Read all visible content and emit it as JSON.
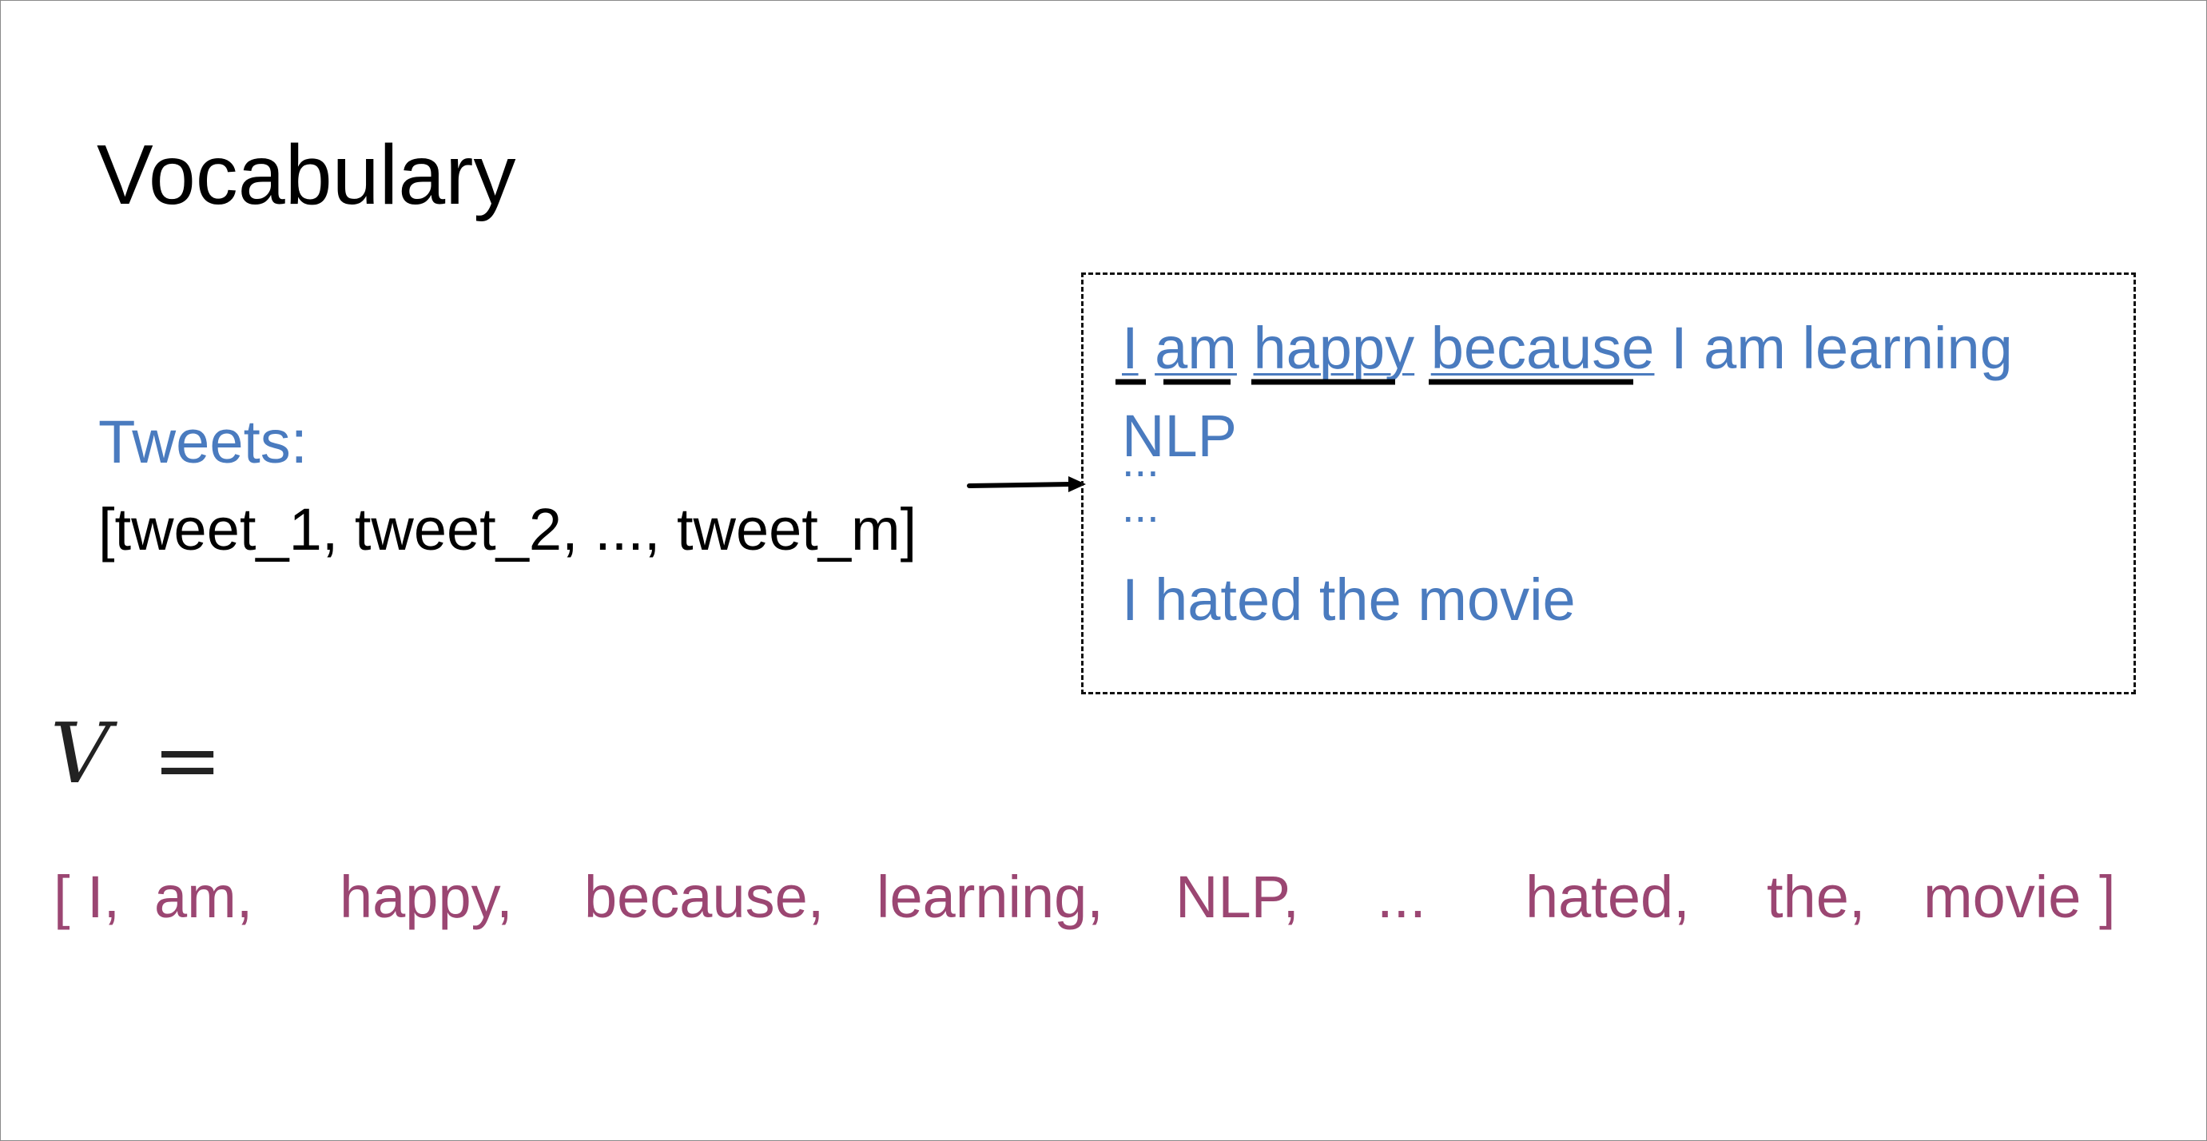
{
  "slide": {
    "title": "Vocabulary",
    "tweets_label": "Tweets:",
    "tweets_list": "[tweet_1, tweet_2, ..., tweet_m]"
  },
  "corpus": {
    "line1_words": [
      "I",
      "am",
      "happy",
      "because"
    ],
    "line1_rest": " I am learning",
    "line2": "NLP",
    "dots1": "...",
    "dots2": "...",
    "line3": "I hated the movie"
  },
  "vocabulary": {
    "symbol": "V",
    "equals": "=",
    "open_bracket": "[",
    "items": [
      "I,",
      "am,",
      "happy,",
      "because,",
      "learning,",
      "NLP,",
      "...",
      "hated,",
      "the,",
      "movie"
    ],
    "close_bracket": "]"
  },
  "colors": {
    "tweet_blue": "#4a7bbf",
    "vocab_purple": "#9b4672",
    "text_black": "#000000"
  }
}
